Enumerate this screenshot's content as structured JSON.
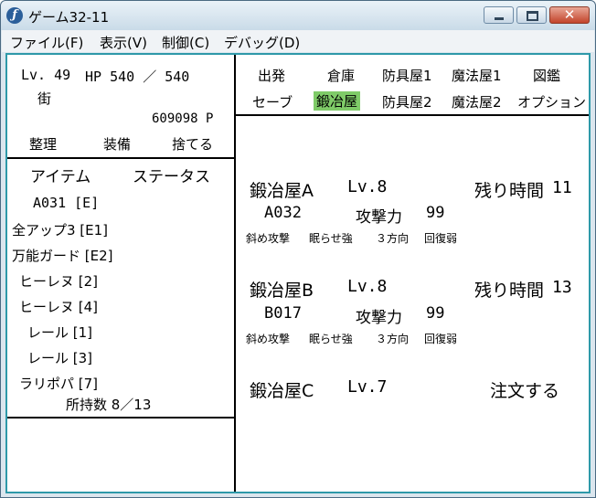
{
  "window": {
    "title": "ゲーム32-11",
    "close_glyph": "✕"
  },
  "menu": [
    "ファイル(F)",
    "表示(V)",
    "制御(C)",
    "デバッグ(D)"
  ],
  "status": {
    "level": "Lv. 49",
    "hp": "HP  540  ／  540",
    "location": "街",
    "money": "609098  P"
  },
  "actions": [
    "整理",
    "装備",
    "捨てる"
  ],
  "inventory_tabs": [
    "アイテム",
    "ステータス"
  ],
  "items": [
    "A031  [E]",
    "全アップ3 [E1]",
    "万能ガード [E2]",
    "ヒーレヌ  [2]",
    "ヒーレヌ  [4]",
    "レール  [1]",
    "レール  [3]",
    "ラリポパ  [7]"
  ],
  "item_count": "所持数  8／13",
  "nav_row1": [
    "出発",
    "倉庫",
    "防具屋1",
    "魔法屋1",
    "図鑑"
  ],
  "nav_row2": [
    "セーブ",
    "鍛冶屋",
    "防具屋2",
    "魔法屋2",
    "オプション"
  ],
  "nav_active": "鍛冶屋",
  "smiths": [
    {
      "name": "鍛冶屋A",
      "level": "Lv.8",
      "time_label": "残り時間",
      "time_value": "11",
      "item": "A032",
      "stat_label": "攻撃力",
      "stat_value": "99",
      "traits": [
        "斜め攻撃",
        "眠らせ強",
        "３方向",
        "回復弱"
      ]
    },
    {
      "name": "鍛冶屋B",
      "level": "Lv.8",
      "time_label": "残り時間",
      "time_value": "13",
      "item": "B017",
      "stat_label": "攻撃力",
      "stat_value": "99",
      "traits": [
        "斜め攻撃",
        "眠らせ強",
        "３方向",
        "回復弱"
      ]
    },
    {
      "name": "鍛冶屋C",
      "level": "Lv.7",
      "order_label": "注文する"
    }
  ],
  "colors": {
    "accent_frame": "#2e99a9",
    "active_tab": "#7fcb68"
  }
}
